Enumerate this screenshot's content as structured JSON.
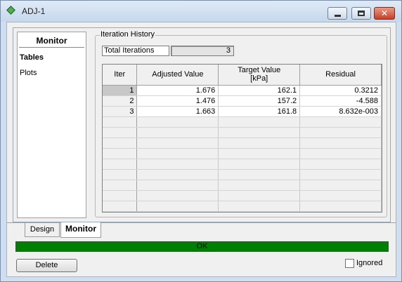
{
  "window": {
    "title": "ADJ-1"
  },
  "nav": {
    "header": "Monitor",
    "items": [
      {
        "label": "Tables"
      },
      {
        "label": "Plots"
      }
    ]
  },
  "iteration_history": {
    "group_label": "Iteration History",
    "total_label": "Total Iterations",
    "total_value": "3",
    "columns": [
      {
        "label": "Iter",
        "unit": ""
      },
      {
        "label": "Adjusted Value",
        "unit": ""
      },
      {
        "label": "Target Value",
        "unit": "[kPa]"
      },
      {
        "label": "Residual",
        "unit": ""
      }
    ],
    "rows": [
      [
        "1",
        "1.676",
        "162.1",
        "0.3212"
      ],
      [
        "2",
        "1.476",
        "157.2",
        "-4.588"
      ],
      [
        "3",
        "1.663",
        "161.8",
        "8.632e-003"
      ]
    ],
    "empty_rows": 10
  },
  "tabs": [
    {
      "label": "Design"
    },
    {
      "label": "Monitor"
    }
  ],
  "status": {
    "text": "OK",
    "color": "#008000"
  },
  "buttons": {
    "delete": "Delete"
  },
  "ignored": {
    "label": "Ignored",
    "checked": false
  }
}
